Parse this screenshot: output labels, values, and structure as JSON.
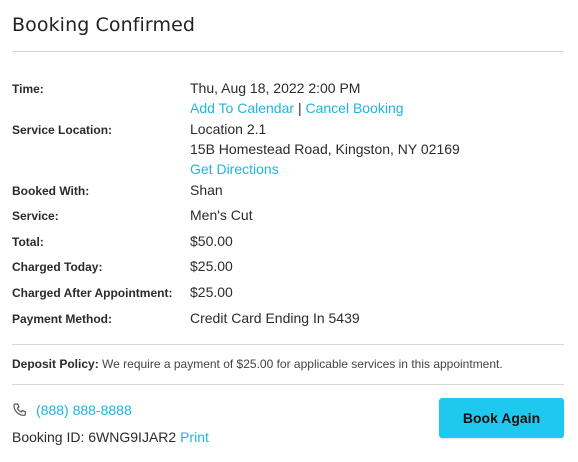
{
  "header": {
    "title": "Booking Confirmed"
  },
  "details": {
    "time_label": "Time:",
    "time_value": "Thu, Aug 18, 2022 2:00 PM",
    "add_to_calendar": "Add To Calendar",
    "link_separator": "|",
    "cancel_booking": "Cancel Booking",
    "location_label": "Service Location:",
    "location_name": "Location 2.1",
    "location_address": "15B Homestead Road, Kingston, NY 02169",
    "get_directions": "Get Directions",
    "booked_with_label": "Booked With:",
    "booked_with_value": "Shan",
    "service_label": "Service:",
    "service_value": "Men's Cut",
    "total_label": "Total:",
    "total_value": "$50.00",
    "charged_today_label": "Charged Today:",
    "charged_today_value": "$25.00",
    "charged_after_label": "Charged After Appointment:",
    "charged_after_value": "$25.00",
    "payment_method_label": "Payment Method:",
    "payment_method_value": "Credit Card Ending In 5439"
  },
  "policy": {
    "label": "Deposit Policy:",
    "text": "We require a payment of $25.00 for applicable services in this appointment."
  },
  "footer": {
    "phone_icon": "phone-icon",
    "phone": "(888) 888-8888",
    "booking_id_label": "Booking ID:",
    "booking_id": "6WNG9IJAR2",
    "print": "Print",
    "book_again": "Book Again"
  },
  "colors": {
    "link": "#1eb5de",
    "button": "#1ec8ee"
  }
}
